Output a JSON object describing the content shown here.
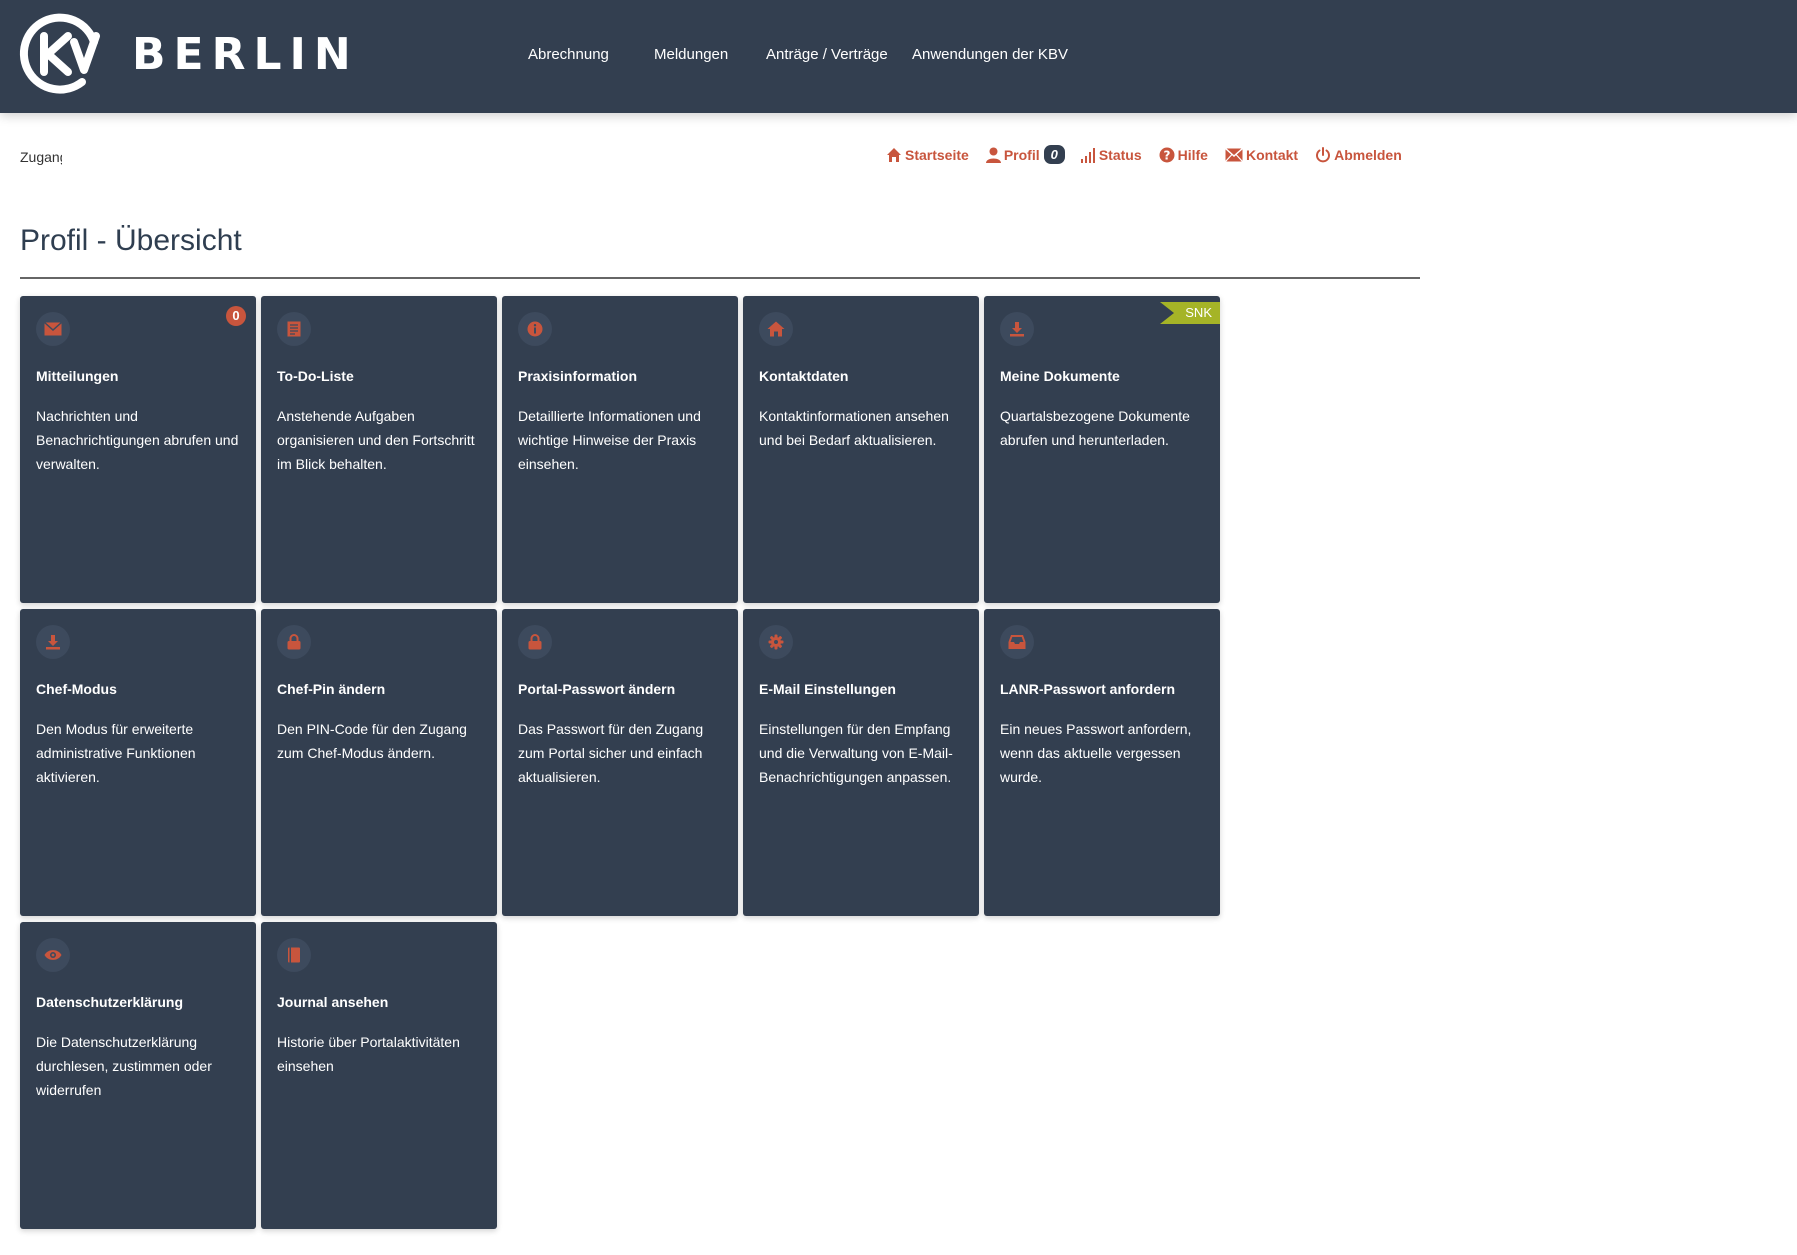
{
  "brand": {
    "name": "BERLIN"
  },
  "nav": [
    "Abrechnung",
    "Meldungen",
    "Anträge / Verträge",
    "Anwendungen der KBV"
  ],
  "breadcrumb": "Zugang",
  "util": {
    "home": "Startseite",
    "profile": "Profil",
    "profile_badge": "0",
    "status": "Status",
    "help": "Hilfe",
    "contact": "Kontakt",
    "logout": "Abmelden"
  },
  "page": {
    "title": "Profil - Übersicht"
  },
  "colors": {
    "header": "#333f50",
    "tile": "#333f50",
    "accent": "#c8553d",
    "ribbon": "#a5b427"
  },
  "tiles": [
    {
      "title": "Mitteilungen",
      "desc": "Nachrichten und Benachrichtigungen abrufen und verwalten.",
      "icon": "mail-icon",
      "badge": "0"
    },
    {
      "title": "To-Do-Liste",
      "desc": "Anstehende Aufgaben organisieren und den Fortschritt im Blick behalten.",
      "icon": "list-icon"
    },
    {
      "title": "Praxisinformation",
      "desc": "Detaillierte Informationen und wichtige Hinweise der Praxis einsehen.",
      "icon": "info-icon"
    },
    {
      "title": "Kontaktdaten",
      "desc": "Kontaktinformationen ansehen und bei Bedarf aktualisieren.",
      "icon": "home-icon"
    },
    {
      "title": "Meine Dokumente",
      "desc": "Quartalsbezogene Dokumente abrufen und herunterladen.",
      "icon": "download-icon",
      "ribbon": "SNK"
    },
    {
      "title": "Chef-Modus",
      "desc": "Den Modus für erweiterte administrative Funktionen aktivieren.",
      "icon": "download-icon"
    },
    {
      "title": "Chef-Pin ändern",
      "desc": "Den PIN-Code für den Zugang zum Chef-Modus ändern.",
      "icon": "lock-icon"
    },
    {
      "title": "Portal-Passwort ändern",
      "desc": "Das Passwort für den Zugang zum Portal sicher und einfach aktualisieren.",
      "icon": "lock-icon"
    },
    {
      "title": "E-Mail Einstellungen",
      "desc": "Einstellungen für den Empfang und die Verwaltung von E-Mail-Benachrichtigungen anpassen.",
      "icon": "gear-icon"
    },
    {
      "title": "LANR-Passwort anfordern",
      "desc": "Ein neues Passwort anfordern, wenn das aktuelle vergessen wurde.",
      "icon": "inbox-icon"
    },
    {
      "title": "Datenschutzerklärung",
      "desc": "Die Datenschutzerklärung durchlesen, zustimmen oder widerrufen",
      "icon": "eye-icon"
    },
    {
      "title": "Journal ansehen",
      "desc": "Historie über Portalaktivitäten einsehen",
      "icon": "book-icon"
    }
  ]
}
